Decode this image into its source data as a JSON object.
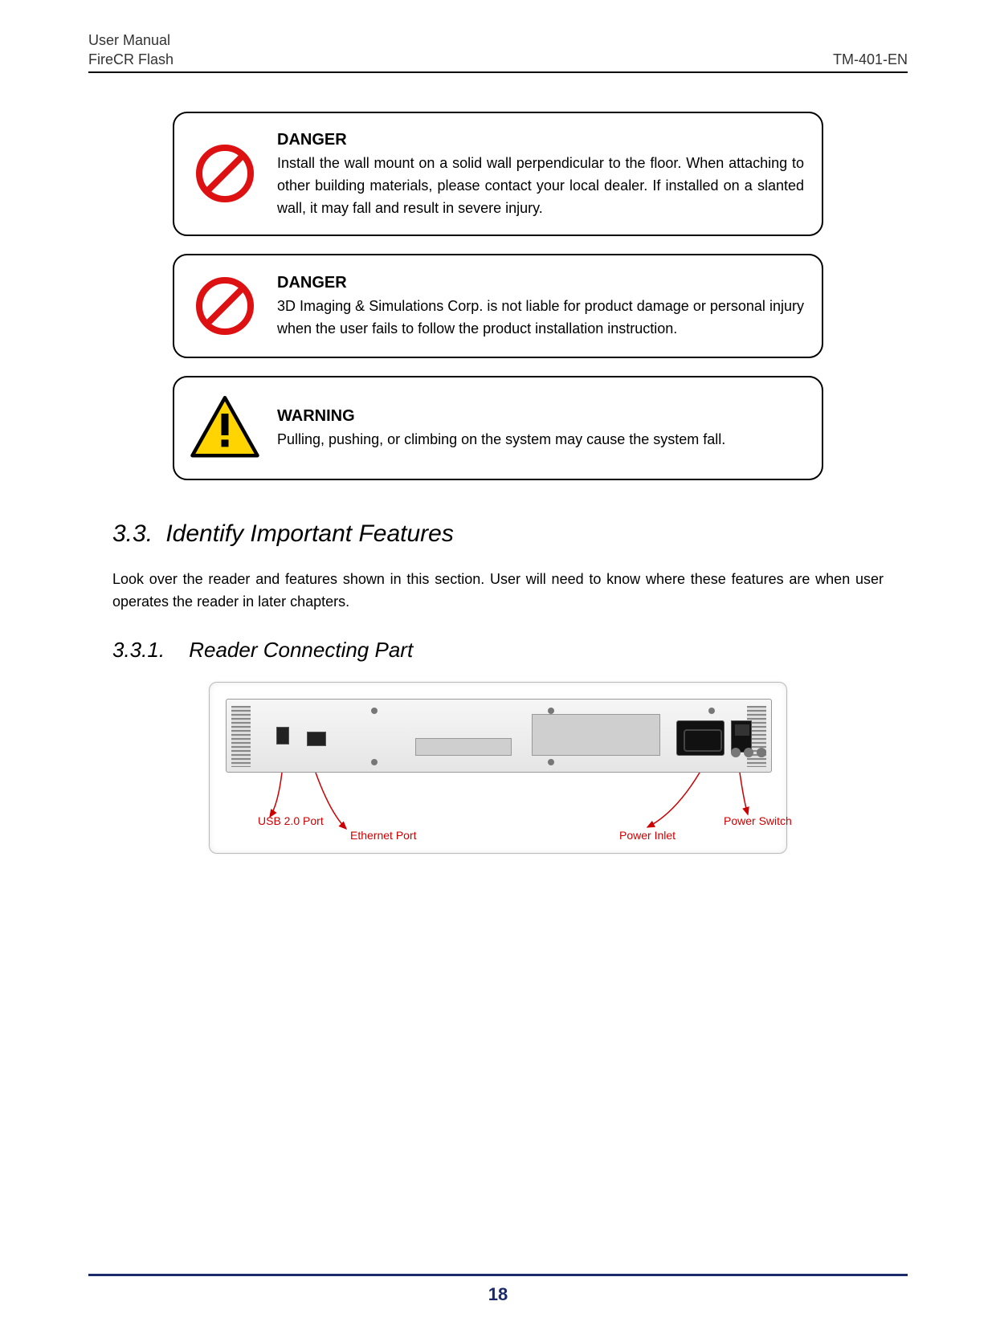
{
  "header": {
    "title": "User Manual",
    "product": "FireCR Flash",
    "doccode": "TM-401-EN"
  },
  "callouts": [
    {
      "type": "danger",
      "title": "DANGER",
      "text": "Install the wall mount on a solid wall perpendicular to the floor. When attaching to other building materials, please contact your local dealer.   If installed on a slanted wall, it may fall and result in severe injury."
    },
    {
      "type": "danger",
      "title": "DANGER",
      "text": "3D Imaging & Simulations Corp. is not liable for product damage or personal injury when the user fails to follow the product installation instruction."
    },
    {
      "type": "warning",
      "title": "WARNING",
      "text": "Pulling, pushing, or climbing on the system may cause the system fall."
    }
  ],
  "section": {
    "number": "3.3.",
    "title": "Identify Important Features",
    "intro": "Look over the reader and features shown in this section.   User will need to know where these features are when user operates the reader in later chapters."
  },
  "subsection": {
    "number": "3.3.1.",
    "title": "Reader Connecting Part"
  },
  "figure_labels": {
    "usb": "USB 2.0 Port",
    "ethernet": "Ethernet Port",
    "power_inlet": "Power Inlet",
    "power_switch": "Power Switch"
  },
  "page_number": "18"
}
